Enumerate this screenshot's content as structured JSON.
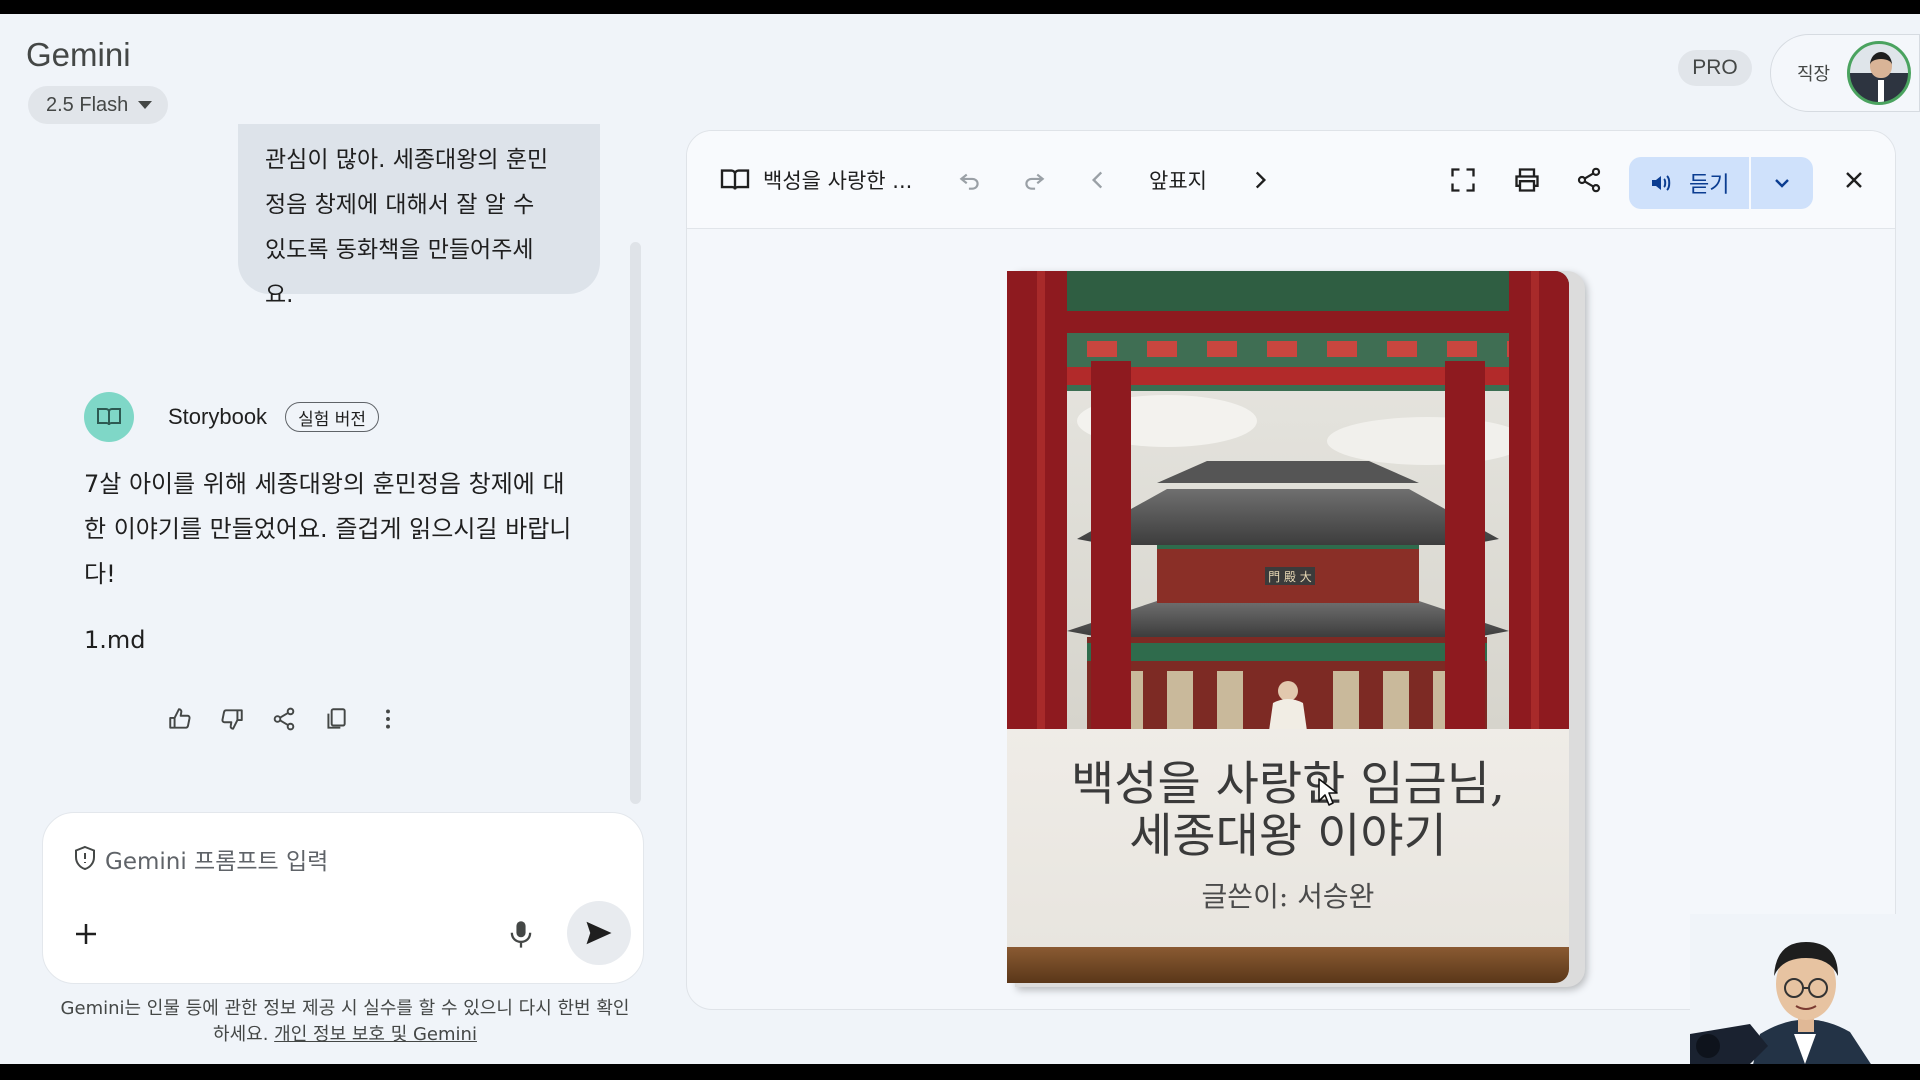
{
  "header": {
    "brand": "Gemini",
    "model": "2.5 Flash",
    "pro_badge": "PRO",
    "account_label": "직장"
  },
  "chat": {
    "user_message": "관심이 많아. 세종대왕의 훈민정음 창제에 대해서 잘 알 수 있도록 동화책을 만들어주세요.",
    "user_message_lines": [
      "관심이 많아. 세종대왕의 훈민",
      "정음 창제에 대해서 잘 알 수",
      "있도록 동화책을 만들어주세",
      "요."
    ],
    "bot_name": "Storybook",
    "bot_tag": "실험 버전",
    "bot_message_lines": [
      "7살 아이를 위해 세종대왕의 훈민정음 창제에 대",
      "한 이야기를 만들었어요. 즐겁게 읽으시길 바랍니",
      "다!"
    ],
    "bot_file": "1.md",
    "action_icons": [
      "thumb-up-icon",
      "thumb-down-icon",
      "share-icon",
      "copy-icon",
      "more-vert-icon"
    ]
  },
  "input": {
    "placeholder": "Gemini 프롬프트 입력"
  },
  "disclaimer": {
    "text": "Gemini는 인물 등에 관한 정보 제공 시 실수를 할 수 있으니 다시 한번 확인하세요.",
    "line1": "Gemini는 인물 등에 관한 정보 제공 시 실수를 할 수 있으니 다시 한번 확인",
    "line2_prefix": "하세요.",
    "link": "개인 정보 보호 및 Gemini"
  },
  "canvas": {
    "title": "백성을 사랑한 ...",
    "page_label": "앞표지",
    "listen_label": "듣기"
  },
  "book": {
    "title_line1": "백성을 사랑한 임금님,",
    "title_line2": "세종대왕 이야기",
    "author": "글쓴이: 서승완",
    "signboard": "門 殿 大"
  },
  "colors": {
    "app_bg": "#f0f4f9",
    "listen_bg": "#cfe1fb",
    "bot_avatar": "#7fd7c7",
    "pillar_red": "#8e1a1f"
  }
}
